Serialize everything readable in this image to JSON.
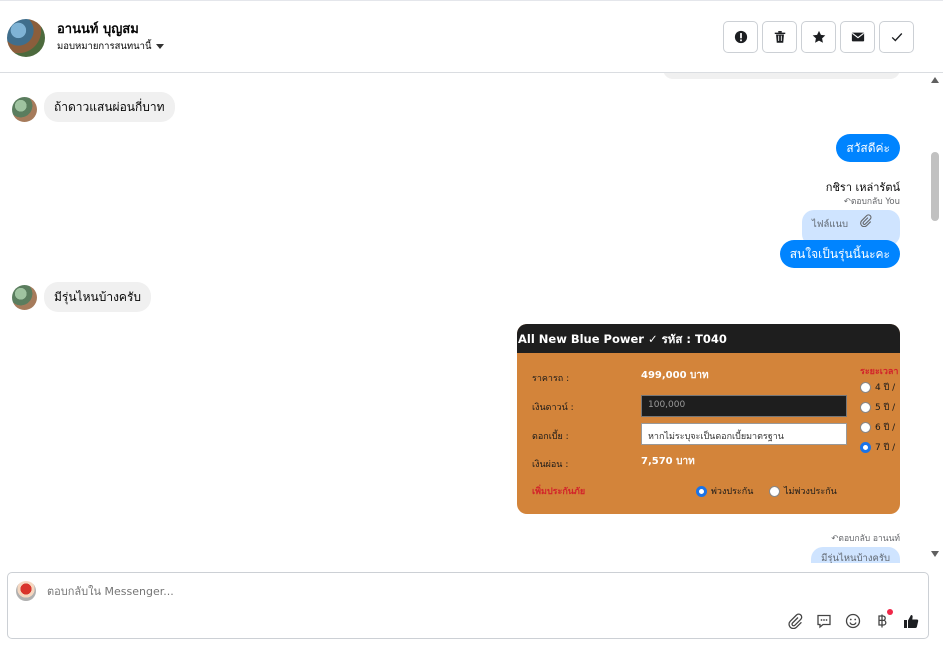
{
  "header": {
    "contact_name": "อานนท์ บุญสม",
    "assign_label": "มอบหมายการสนทนานี้",
    "actions": [
      {
        "name": "report",
        "icon": "exclamation-icon"
      },
      {
        "name": "delete",
        "icon": "trash-icon"
      },
      {
        "name": "star",
        "icon": "star-icon"
      },
      {
        "name": "mark-unread",
        "icon": "envelope-icon"
      },
      {
        "name": "done",
        "icon": "check-icon"
      }
    ]
  },
  "messages": {
    "m1_in": "ถ้าดาวแสนผ่อนกี่บาท",
    "m2_out": "สวัสดีค่ะ",
    "reply_sender": "กชิรา เหล่ารัตน์",
    "reply_note_1": "↶ตอบกลับ You",
    "attachment_quote": "ไฟล์แนบ",
    "m3_out": "สนใจเป็นรุ่นนี้นะคะ",
    "m4_in": "มีรุ่นไหนบ้างครับ",
    "reply_note_2": "↶ตอบกลับ อานนท์",
    "quote_2": "มีรุ่นไหนบ้างครับ"
  },
  "card": {
    "title": "All New Blue Power ✓ รหัส : T040",
    "price_label": "ราคารถ :",
    "price_value": "499,000 บาท",
    "down_label": "เงินดาวน์ :",
    "down_value": "100,000",
    "interest_label": "ดอกเบี้ย :",
    "interest_value": "หากไม่ระบุจะเป็นดอกเบี้ยมาตรฐาน",
    "installment_label": "เงินผ่อน :",
    "installment_value": "7,570 บาท",
    "insurance_label": "เพิ่มประกันภัย",
    "opt_with": "พ่วงประกัน",
    "opt_without": "ไม่พ่วงประกัน",
    "period_label": "ระยะเวลา",
    "periods": [
      "4 ปี /",
      "5 ปี /",
      "6 ปี /",
      "7 ปี /"
    ],
    "selected_period_index": 3,
    "insurance_selected": "with"
  },
  "composer": {
    "placeholder": "ตอบกลับใน Messenger...",
    "tools": [
      "paperclip-icon",
      "speech-bubble-icon",
      "smiley-icon",
      "baht-icon",
      "thumbs-up-icon"
    ]
  },
  "colors": {
    "accent": "#0084ff",
    "incoming_bubble": "#f0f0f0",
    "reply_quote": "#cfe4ff",
    "card_bg": "#d3843a",
    "card_header": "#1e1e1e",
    "alert_red": "#d2232a"
  }
}
